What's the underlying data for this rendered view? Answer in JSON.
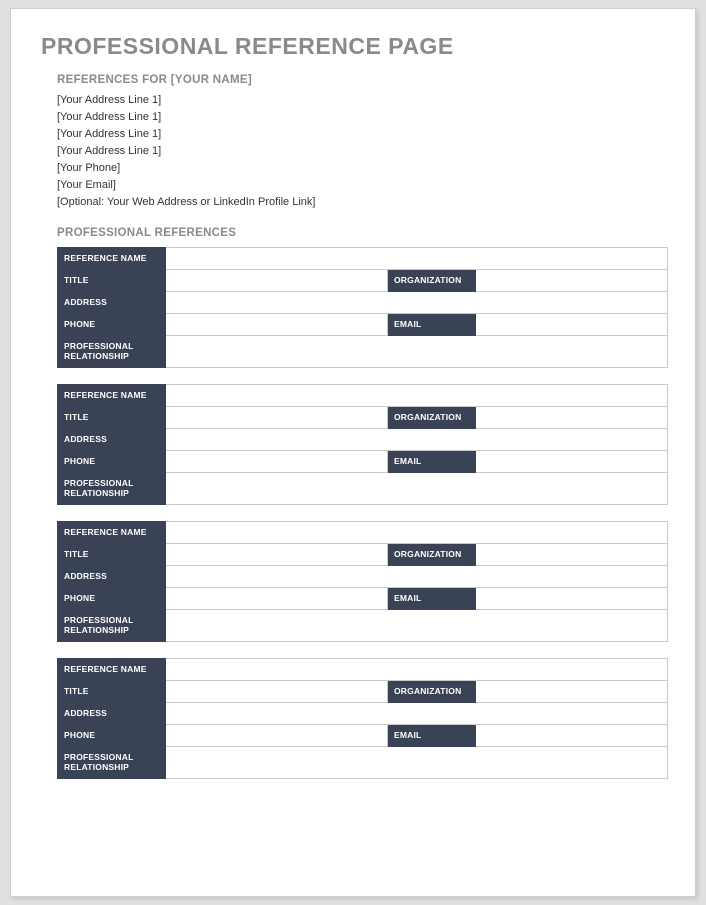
{
  "title": "PROFESSIONAL REFERENCE PAGE",
  "references_for": "REFERENCES FOR [YOUR NAME]",
  "address_lines": [
    "[Your Address Line 1]",
    "[Your Address Line 1]",
    "[Your Address Line 1]",
    "[Your Address Line 1]",
    "[Your Phone]",
    "[Your Email]",
    "[Optional: Your Web Address or LinkedIn Profile Link]"
  ],
  "section_header": "PROFESSIONAL REFERENCES",
  "field_labels": {
    "reference_name": "REFERENCE NAME",
    "title": "TITLE",
    "organization": "ORGANIZATION",
    "address": "ADDRESS",
    "phone": "PHONE",
    "email": "EMAIL",
    "professional_relationship": "PROFESSIONAL RELATIONSHIP"
  },
  "reference_count": 4
}
